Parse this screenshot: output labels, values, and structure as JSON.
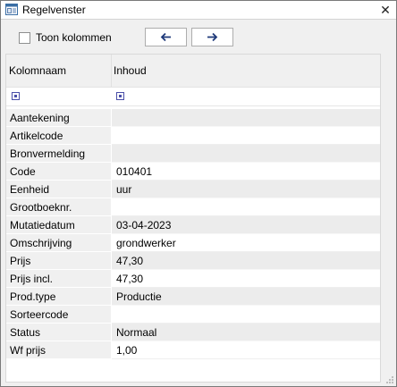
{
  "window": {
    "title": "Regelvenster",
    "close_glyph": "✕",
    "icon": "window-app-icon"
  },
  "toolbar": {
    "show_columns_label": "Toon kolommen",
    "show_columns_checked": false,
    "prev_icon": "arrow-left-icon",
    "next_icon": "arrow-right-icon"
  },
  "grid": {
    "headers": [
      "Kolomnaam",
      "Inhoud"
    ],
    "rows": [
      {
        "name": "Aantekening",
        "value": ""
      },
      {
        "name": "Artikelcode",
        "value": ""
      },
      {
        "name": "Bronvermelding",
        "value": ""
      },
      {
        "name": "Code",
        "value": "010401"
      },
      {
        "name": "Eenheid",
        "value": "uur"
      },
      {
        "name": "Grootboeknr.",
        "value": ""
      },
      {
        "name": "Mutatiedatum",
        "value": "03-04-2023"
      },
      {
        "name": "Omschrijving",
        "value": "grondwerker"
      },
      {
        "name": "Prijs",
        "value": "47,30"
      },
      {
        "name": "Prijs incl.",
        "value": "47,30"
      },
      {
        "name": "Prod.type",
        "value": "Productie"
      },
      {
        "name": "Sorteercode",
        "value": ""
      },
      {
        "name": "Status",
        "value": "Normaal"
      },
      {
        "name": "Wf prijs",
        "value": "1,00"
      }
    ]
  }
}
